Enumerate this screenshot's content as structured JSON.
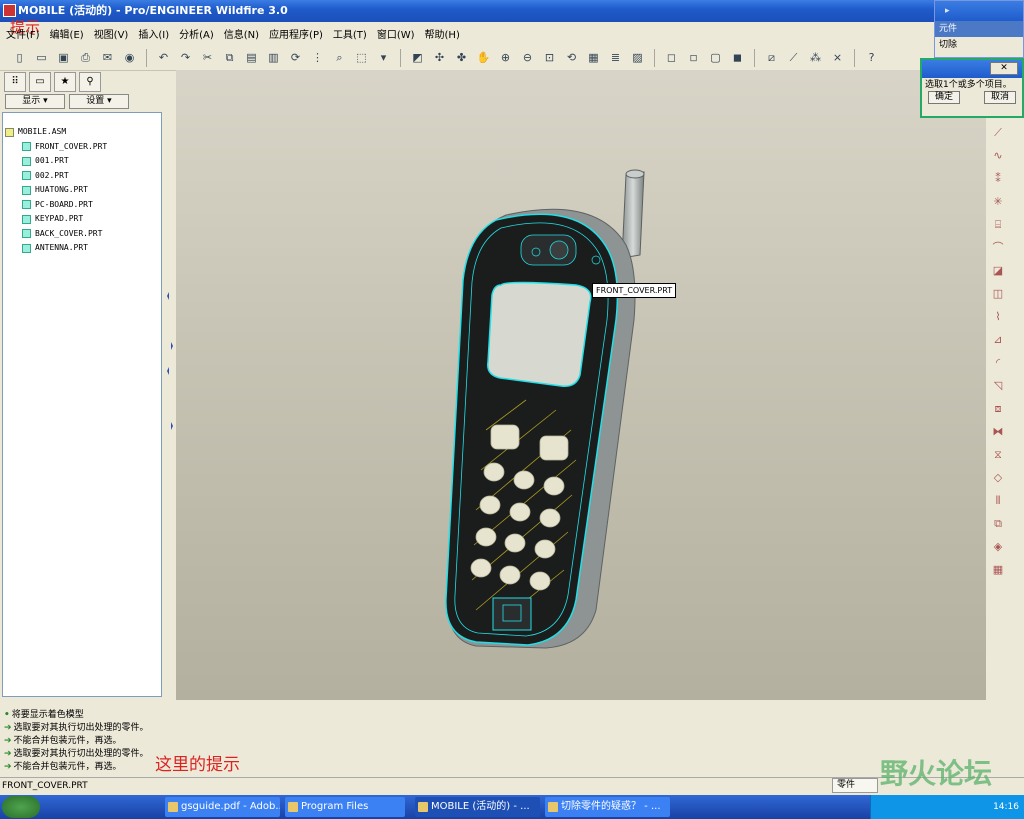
{
  "window": {
    "title": "MOBILE (活动的) - Pro/ENGINEER Wildfire 3.0"
  },
  "annotations": {
    "top_hint": "提示",
    "bottom_hint": "这里的提示"
  },
  "menubar": [
    "文件(F)",
    "编辑(E)",
    "视图(V)",
    "插入(I)",
    "分析(A)",
    "信息(N)",
    "应用程序(P)",
    "工具(T)",
    "窗口(W)",
    "帮助(H)"
  ],
  "left_panel": {
    "show_button": "显示 ▾",
    "settings_button": "设置 ▾",
    "tree": {
      "root": "MOBILE.ASM",
      "children": [
        "FRONT_COVER.PRT",
        "001.PRT",
        "002.PRT",
        "HUATONG.PRT",
        "PC-BOARD.PRT",
        "KEYPAD.PRT",
        "BACK_COVER.PRT",
        "ANTENNA.PRT"
      ]
    }
  },
  "viewport": {
    "tooltip": "FRONT_COVER.PRT"
  },
  "menu_manager": {
    "item_selected": "元件",
    "item_other": "切除"
  },
  "select_dialog": {
    "message": "选取1个或多个项目。",
    "ok": "确定",
    "cancel": "取消"
  },
  "messages": [
    "将要显示着色模型",
    "选取要对其执行切出处理的零件。",
    "不能合并包装元件，再选。",
    "选取要对其执行切出处理的零件。",
    "不能合并包装元件，再选。"
  ],
  "status": {
    "text": "FRONT_COVER.PRT",
    "filter": "零件"
  },
  "watermark": "野火论坛",
  "taskbar": {
    "tasks": [
      "gsguide.pdf - Adob...",
      "Program Files",
      "MOBILE (活动的) - ...",
      "切除零件的疑惑？ - ..."
    ],
    "clock": "14:16"
  },
  "colors": {
    "model_edge": "#20e0e8",
    "model_body": "#1a1a1a",
    "hint_red": "#dd2222"
  }
}
